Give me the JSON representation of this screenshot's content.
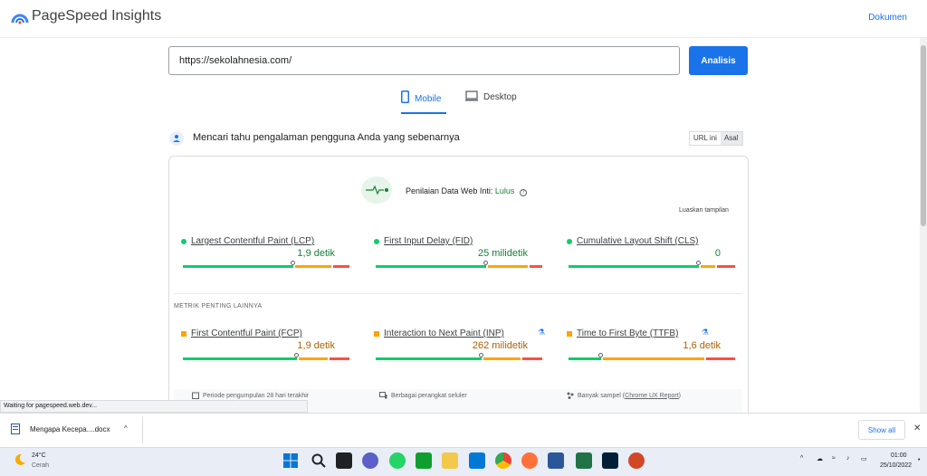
{
  "header": {
    "title": "PageSpeed Insights",
    "docs_link": "Dokumen"
  },
  "search": {
    "url_value": "https://sekolahnesia.com/",
    "analyze_label": "Analisis"
  },
  "tabs": [
    {
      "label": "Mobile",
      "active": true
    },
    {
      "label": "Desktop",
      "active": false
    }
  ],
  "field_data": {
    "heading": "Mencari tahu pengalaman pengguna Anda yang sebenarnya",
    "toggle": [
      "URL ini",
      "Asal"
    ],
    "cwv_label": "Penilaian Data Web Inti:",
    "cwv_status": "Lulus",
    "expand": "Luaskan tampilan",
    "core_metrics": [
      {
        "name": "Largest Contentful Paint (LCP)",
        "value": "1,9 detik",
        "status": "green",
        "distribution": [
          0.68,
          0.22,
          0.1
        ]
      },
      {
        "name": "First Input Delay (FID)",
        "value": "25 milidetik",
        "status": "green",
        "distribution": [
          0.68,
          0.24,
          0.08
        ]
      },
      {
        "name": "Cumulative Layout Shift (CLS)",
        "value": "0",
        "status": "green",
        "distribution": [
          0.8,
          0.09,
          0.11
        ]
      }
    ],
    "other_heading": "METRIK PENTING LAINNYA",
    "other_metrics": [
      {
        "name": "First Contentful Paint (FCP)",
        "value": "1,9 detik",
        "status": "orange",
        "lab": false,
        "distribution": [
          0.7,
          0.18,
          0.12
        ]
      },
      {
        "name": "Interaction to Next Paint (INP)",
        "value": "262 milidetik",
        "status": "orange",
        "lab": true,
        "distribution": [
          0.65,
          0.23,
          0.12
        ]
      },
      {
        "name": "Time to First Byte (TTFB)",
        "value": "1,6 detik",
        "status": "orange",
        "lab": true,
        "distribution": [
          0.2,
          0.62,
          0.18
        ]
      }
    ],
    "footer": [
      "Periode pengumpulan 28 hari terakhir",
      "Berbagai perangkat seluler",
      "Banyak sampel (",
      "Chrome UX Report",
      ")"
    ]
  },
  "status_text": "Waiting for pagespeed.web.dev...",
  "downloads": {
    "file_name": "Mengapa Kecepa....docx",
    "show_all": "Show all"
  },
  "taskbar": {
    "temperature": "24°C",
    "condition": "Cerah",
    "time": "01:00",
    "date": "25/10/2022"
  },
  "colors": {
    "good": "#0cce6b",
    "average": "#ffa400",
    "poor": "#ff4e42",
    "accent": "#1a73e8"
  }
}
